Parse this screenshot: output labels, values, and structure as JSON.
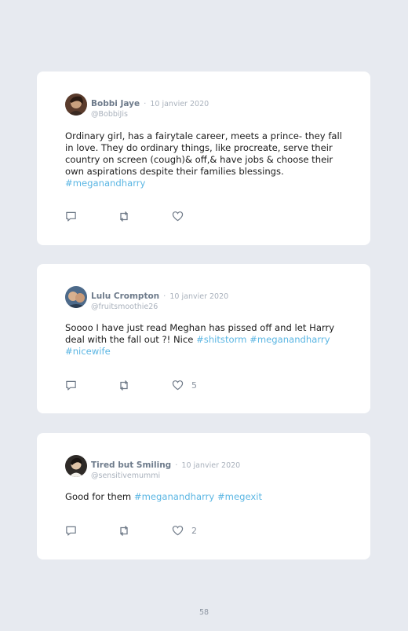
{
  "tweets": [
    {
      "name": "Bobbi Jaye",
      "date": "10 janvier 2020",
      "handle": "@BobbiJis",
      "text_parts": [
        {
          "text": "Ordinary girl, has a fairytale career, meets a prince- they fall\nin love. They do ordinary things, like procreate, serve their\ncountry on screen (cough)& off,& have jobs & choose their\nown aspirations despite their families blessings.\n",
          "tag": false
        },
        {
          "text": "#meganandharry",
          "tag": true
        }
      ],
      "likes": ""
    },
    {
      "name": "Lulu Crompton",
      "date": "10 janvier 2020",
      "handle": "@fruitsmoothie26",
      "text_parts": [
        {
          "text": "Soooo I have just read Meghan has pissed off and let Harry\ndeal with the fall out ?! Nice ",
          "tag": false
        },
        {
          "text": "#shitstorm",
          "tag": true
        },
        {
          "text": " ",
          "tag": false
        },
        {
          "text": "#meganandharry",
          "tag": true
        },
        {
          "text": "\n",
          "tag": false
        },
        {
          "text": "#nicewife",
          "tag": true
        }
      ],
      "likes": "5"
    },
    {
      "name": "Tired but Smiling",
      "date": "10 janvier 2020",
      "handle": "@sensitivemummi",
      "text_parts": [
        {
          "text": "Good for them ",
          "tag": false
        },
        {
          "text": "#meganandharry",
          "tag": true
        },
        {
          "text": " ",
          "tag": false
        },
        {
          "text": "#megexit",
          "tag": true
        }
      ],
      "likes": "2"
    }
  ],
  "separator": "·",
  "icons": [
    "reply-icon",
    "retweet-icon",
    "like-icon"
  ],
  "colors": {
    "background": "#e7eaf0",
    "hashtag": "#5bb6e3",
    "name": "#6e7b8b",
    "muted": "#a9b1bc"
  },
  "page_number": "58"
}
